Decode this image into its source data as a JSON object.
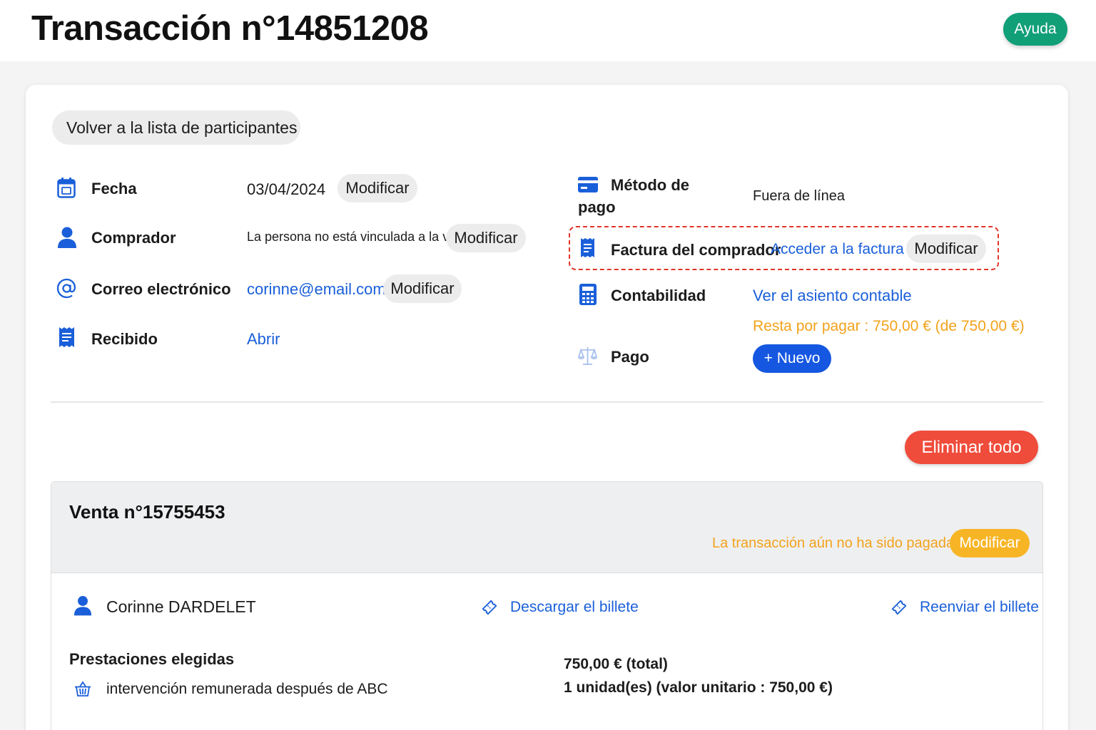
{
  "header": {
    "title": "Transacción n°14851208",
    "help_label": "Ayuda"
  },
  "back_label": "Volver a la lista de participantes",
  "left": {
    "fecha": {
      "label": "Fecha",
      "value": "03/04/2024",
      "action": "Modificar",
      "icon": "calendar-icon"
    },
    "comprador": {
      "label": "Comprador",
      "value": "La persona no está vinculada a la venta",
      "action": "Modificar",
      "icon": "user-icon"
    },
    "correo": {
      "label": "Correo electrónico",
      "value": "corinne@email.com",
      "action": "Modificar",
      "icon": "at-icon"
    },
    "recibido": {
      "label": "Recibido",
      "value": "Abrir",
      "icon": "receipt-icon"
    }
  },
  "right": {
    "metodo": {
      "label_line1": "Método de",
      "label_line2": "pago",
      "value": "Fuera de línea",
      "icon": "credit-card-icon"
    },
    "factura": {
      "label": "Factura del comprador",
      "link": "Acceder a la factura",
      "action": "Modificar",
      "icon": "invoice-icon"
    },
    "contabilidad": {
      "label": "Contabilidad",
      "link": "Ver el asiento contable",
      "icon": "calculator-icon"
    },
    "remaining": "Resta por pagar : 750,00 € (de 750,00 €)",
    "pago": {
      "label": "Pago",
      "action": "+ Nuevo",
      "icon": "scale-icon"
    }
  },
  "delete_all_label": "Eliminar todo",
  "sale": {
    "title": "Venta n°15755453",
    "status": "La transacción aún no ha sido pagada.",
    "status_action": "Modificar",
    "person": "Corinne DARDELET",
    "download_ticket": "Descargar el billete",
    "resend_ticket": "Reenviar el billete",
    "services_title": "Prestaciones elegidas",
    "item": "intervención remunerada después de ABC",
    "total": "750,00 € (total)",
    "units": "1 unidad(es) (valor unitario  : 750,00 €)"
  },
  "colors": {
    "accent_blue": "#1a5fd9",
    "help_green": "#119f78",
    "danger_red": "#ef4c3c",
    "warning_orange": "#f2a21b"
  }
}
